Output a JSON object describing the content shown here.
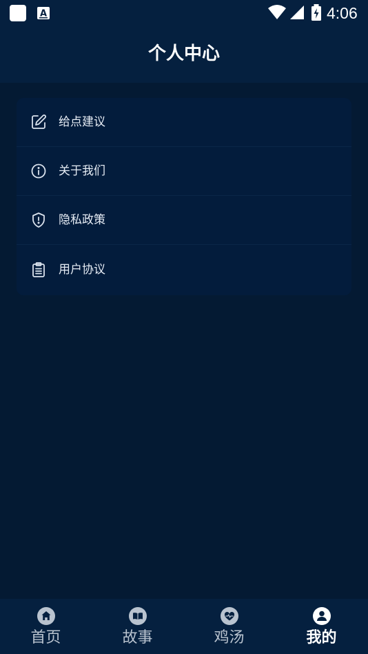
{
  "status_bar": {
    "time": "4:06"
  },
  "header": {
    "title": "个人中心"
  },
  "menu": {
    "items": [
      {
        "label": "给点建议",
        "icon": "edit-icon"
      },
      {
        "label": "关于我们",
        "icon": "info-icon"
      },
      {
        "label": "隐私政策",
        "icon": "shield-icon"
      },
      {
        "label": "用户协议",
        "icon": "clipboard-icon"
      }
    ]
  },
  "tabbar": {
    "tabs": [
      {
        "label": "首页",
        "icon": "home-icon",
        "active": false
      },
      {
        "label": "故事",
        "icon": "book-icon",
        "active": false
      },
      {
        "label": "鸡汤",
        "icon": "heart-pulse-icon",
        "active": false
      },
      {
        "label": "我的",
        "icon": "user-icon",
        "active": true
      }
    ]
  },
  "colors": {
    "background": "#041a33",
    "bar": "#05203f",
    "card": "#031c3c",
    "text": "#ffffff",
    "muted": "#b9c3cf"
  }
}
